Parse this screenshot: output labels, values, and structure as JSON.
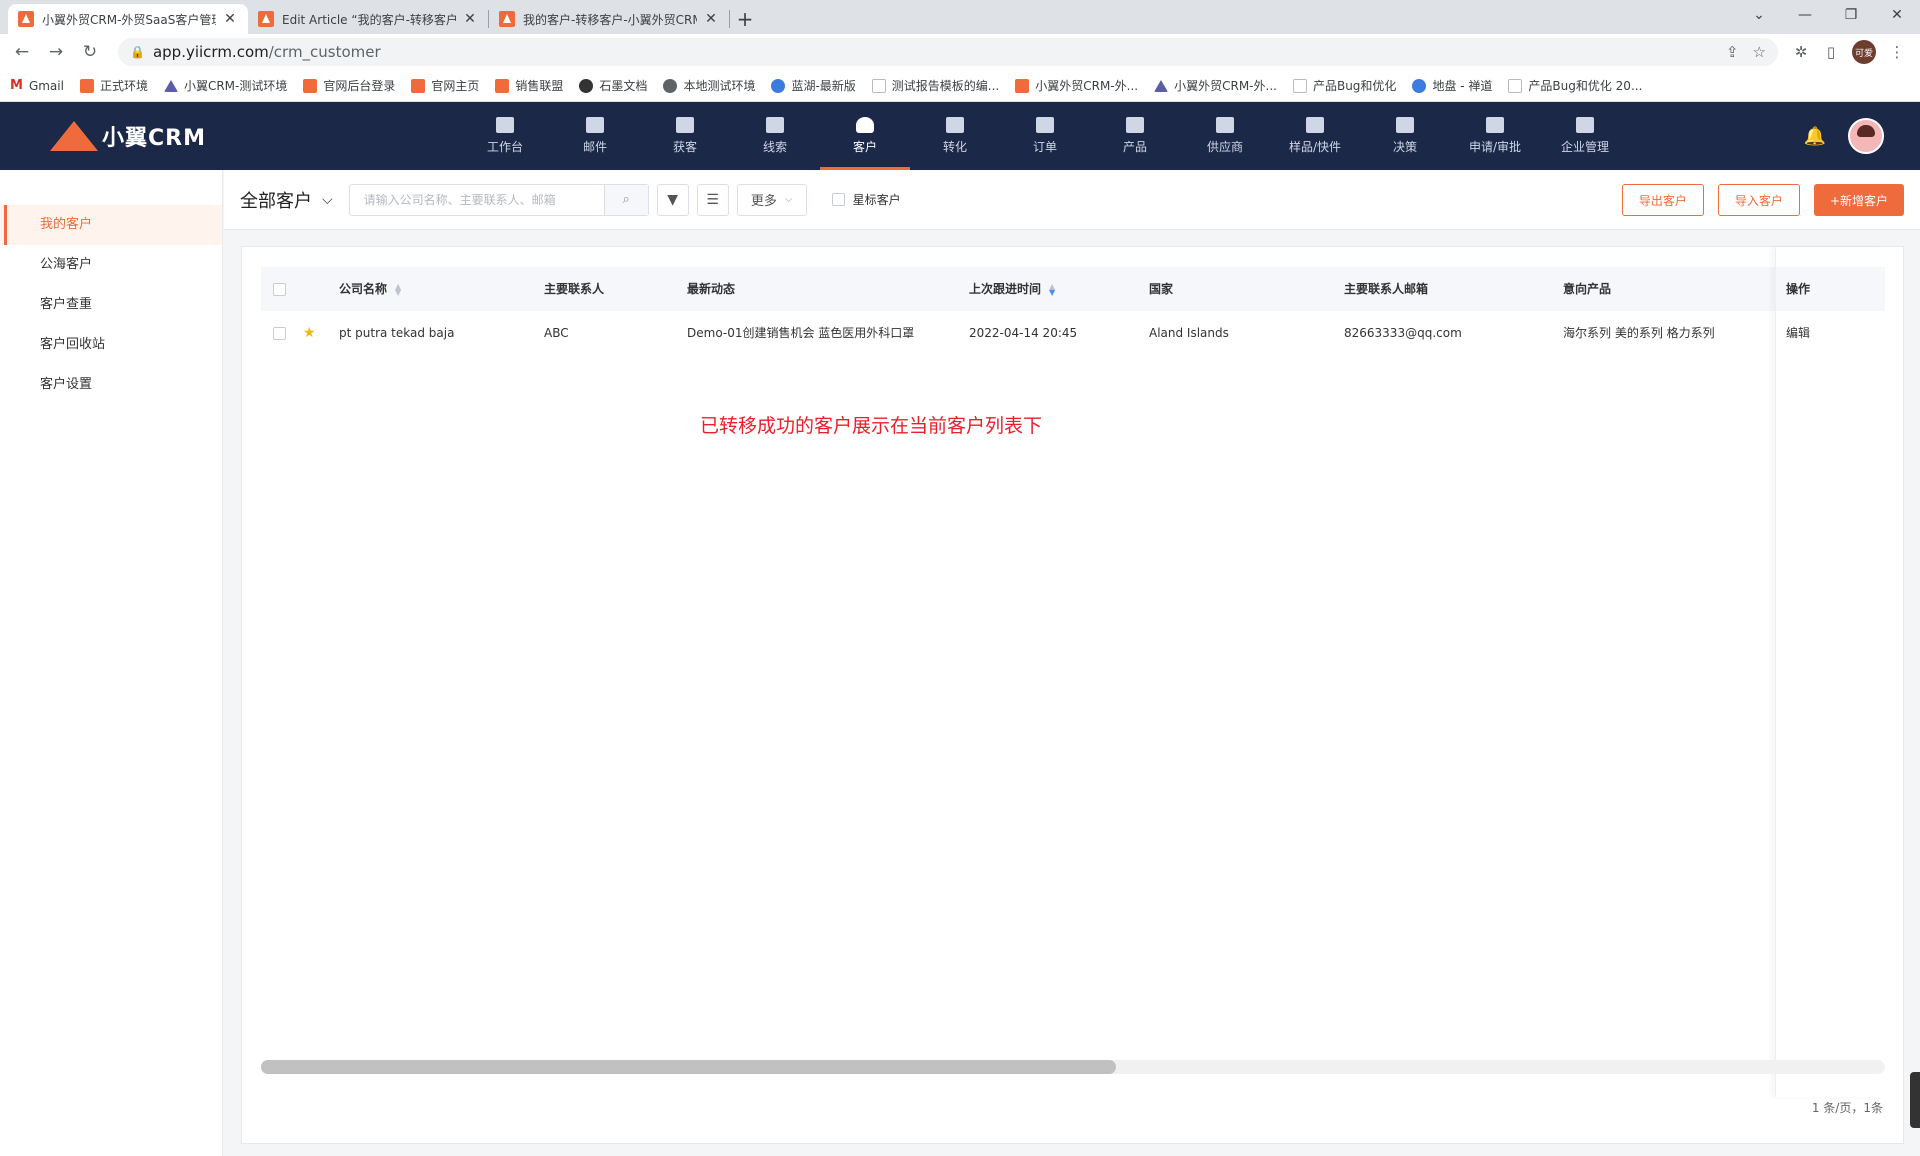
{
  "browser": {
    "tabs": [
      {
        "title": "小翼外贸CRM-外贸SaaS客户管理",
        "active": true
      },
      {
        "title": "Edit Article “我的客户-转移客户",
        "active": false
      },
      {
        "title": "我的客户-转移客户-小翼外贸CRM",
        "active": false
      }
    ],
    "url_host": "app.yiicrm.com",
    "url_path": "/crm_customer",
    "profile_label": "可爱",
    "bookmarks": [
      {
        "label": "Gmail",
        "icon": "gmail-icon"
      },
      {
        "label": "正式环境",
        "icon": "xiaoyi-logo-icon"
      },
      {
        "label": "小翼CRM-测试环境",
        "icon": "triangle-logo-icon"
      },
      {
        "label": "官网后台登录",
        "icon": "xiaoyi-logo-icon"
      },
      {
        "label": "官网主页",
        "icon": "xiaoyi-logo-icon"
      },
      {
        "label": "销售联盟",
        "icon": "xiaoyi-logo-icon"
      },
      {
        "label": "石墨文档",
        "icon": "shimo-icon"
      },
      {
        "label": "本地测试环境",
        "icon": "globe-icon"
      },
      {
        "label": "蓝湖-最新版",
        "icon": "lanhu-icon"
      },
      {
        "label": "测试报告模板的编...",
        "icon": "doc-icon"
      },
      {
        "label": "小翼外贸CRM-外...",
        "icon": "xiaoyi-logo-icon"
      },
      {
        "label": "小翼外贸CRM-外...",
        "icon": "triangle-logo-icon"
      },
      {
        "label": "产品Bug和优化",
        "icon": "page-icon"
      },
      {
        "label": "地盘 - 禅道",
        "icon": "zentao-icon"
      },
      {
        "label": "产品Bug和优化 20...",
        "icon": "page-icon"
      }
    ]
  },
  "app": {
    "logo_text": "小翼CRM",
    "nav": [
      {
        "label": "工作台",
        "key": "workbench"
      },
      {
        "label": "邮件",
        "key": "mail"
      },
      {
        "label": "获客",
        "key": "acquire"
      },
      {
        "label": "线索",
        "key": "leads"
      },
      {
        "label": "客户",
        "key": "customer",
        "active": true
      },
      {
        "label": "转化",
        "key": "convert"
      },
      {
        "label": "订单",
        "key": "order"
      },
      {
        "label": "产品",
        "key": "product"
      },
      {
        "label": "供应商",
        "key": "supplier"
      },
      {
        "label": "样品/快件",
        "key": "sample"
      },
      {
        "label": "决策",
        "key": "decision"
      },
      {
        "label": "申请/审批",
        "key": "approval"
      },
      {
        "label": "企业管理",
        "key": "company"
      }
    ]
  },
  "sidebar": {
    "items": [
      {
        "label": "我的客户",
        "active": true
      },
      {
        "label": "公海客户"
      },
      {
        "label": "客户查重"
      },
      {
        "label": "客户回收站"
      },
      {
        "label": "客户设置"
      }
    ]
  },
  "toolbar": {
    "view_label": "全部客户",
    "search_placeholder": "请输入公司名称、主要联系人、邮箱",
    "more_label": "更多",
    "star_filter_label": "星标客户",
    "export_label": "导出客户",
    "import_label": "导入客户",
    "add_label": "+新增客户"
  },
  "table": {
    "columns": {
      "company": "公司名称",
      "contact": "主要联系人",
      "activity": "最新动态",
      "last_follow": "上次跟进时间",
      "country": "国家",
      "email": "主要联系人邮箱",
      "product": "意向产品",
      "action": "操作"
    },
    "rows": [
      {
        "starred": true,
        "company": "pt putra tekad baja",
        "contact": "ABC",
        "activity": "Demo-01创建销售机会 蓝色医用外科口罩",
        "last_follow": "2022-04-14 20:45",
        "country": "Aland Islands",
        "email": "82663333@qq.com",
        "product": "海尔系列 美的系列 格力系列",
        "action": "编辑"
      }
    ],
    "annotation": "已转移成功的客户展示在当前客户列表下",
    "pagination": "1 条/页，1条"
  }
}
